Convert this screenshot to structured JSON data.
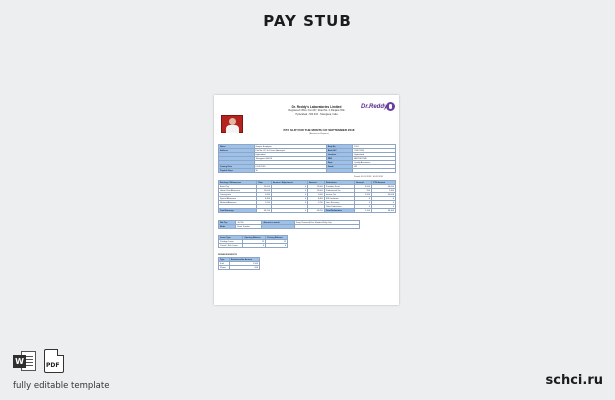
{
  "header": {
    "title": "PAY STUB"
  },
  "document": {
    "company": "Dr. Reddy's Laboratories Limited",
    "address_line1": "Registered Office: 8-2-337, Road No. 3, Banjara Hills",
    "address_line2": "Hyderabad - 500 034 · Telangana, India",
    "logo_text": "Dr.Reddy's",
    "slip_title": "PAY SLIP FOR THE MONTH OF SEPTEMBER 2018",
    "slip_subtitle": "(Amount in Rupees)",
    "employee_info": [
      [
        "Name",
        "Sample Employee",
        "Emp No.",
        "1001"
      ],
      [
        "Address",
        "Plot No. 42, 3rd Cross, Ameerpet",
        "Bank A/C",
        "XXXX1234"
      ],
      [
        "",
        "Hyderabad",
        "Location",
        "Hyderabad"
      ],
      [
        "",
        "Telangana 500016",
        "PAN",
        "ABCDE1234F"
      ],
      [
        "",
        "",
        "Dept.",
        "Quality Assurance"
      ],
      [
        "Joining Date",
        "01.06.2015",
        "Grade",
        "M2"
      ],
      [
        "Payable Days",
        "30",
        "",
        ""
      ]
    ],
    "pay_period_note": "Period: 01.09.2018 - 30.09.2018",
    "earnings_header": [
      "Earnings / Allowances",
      "Rate",
      "Arrears / Adjustment",
      "Amount",
      "Deductions",
      "Amount",
      "YTD Amount"
    ],
    "earnings_rows": [
      [
        "Basic Pay",
        "25,000",
        "0",
        "25,000",
        "Provident Fund",
        "3,000",
        "36,000"
      ],
      [
        "House Rent Allowance",
        "10,000",
        "0",
        "10,000",
        "Professional Tax",
        "200",
        "2,400"
      ],
      [
        "Conveyance",
        "1,600",
        "0",
        "1,600",
        "Income Tax",
        "2,500",
        "30,000"
      ],
      [
        "Special Allowance",
        "8,400",
        "0",
        "8,400",
        "ESI Deduction",
        "0",
        "0"
      ],
      [
        "Medical Allowance",
        "1,250",
        "0",
        "1,250",
        "Loan Recovery",
        "0",
        "0"
      ],
      [
        "",
        "",
        "",
        "",
        "Other Deductions",
        "0",
        "0"
      ]
    ],
    "totals_row": [
      "Total Earnings",
      "46,250",
      "0",
      "46,250",
      "Total Deductions",
      "5,700",
      "68,400"
    ],
    "net_pay": [
      [
        "Net Pay",
        "40,550",
        "Amount in words",
        "Forty Thousand Five Hundred Fifty Only"
      ],
      [
        "Mode",
        "Bank Transfer",
        "",
        ""
      ]
    ],
    "leave_header": [
      "Leave Type",
      "Opening Balance",
      "Closing Balance"
    ],
    "leave_rows": [
      [
        "Privilege Leave",
        "12",
        "12"
      ],
      [
        "Casual / Sick Leave",
        "6",
        "6"
      ]
    ],
    "reimb_title": "REIMBURSEMENTS",
    "reimb_header": [
      "Type",
      "Reimbursable Amount"
    ],
    "reimb_rows": [
      [
        "Fuel",
        "1,500"
      ],
      [
        "Phone",
        "500"
      ]
    ]
  },
  "footer": {
    "word_icon_letter": "W",
    "pdf_icon_text": "PDF",
    "tagline": "fully editable template",
    "brand": "schci.ru"
  }
}
